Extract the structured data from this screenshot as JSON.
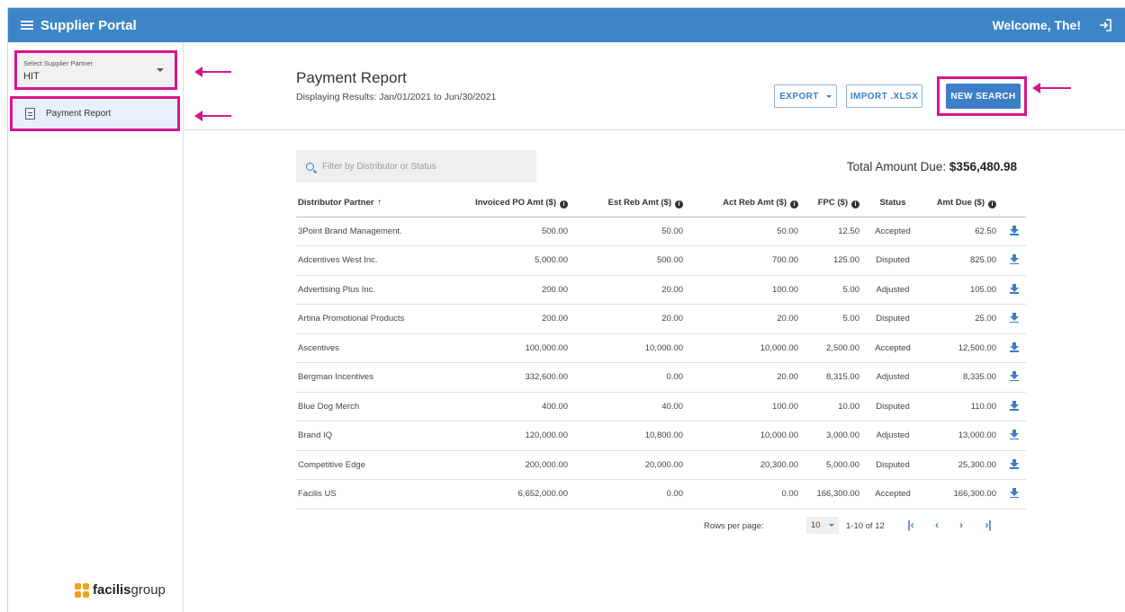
{
  "header": {
    "title": "Supplier Portal",
    "welcome": "Welcome, The!"
  },
  "sidebar": {
    "supplier_select": {
      "label": "Select Supplier Partner",
      "value": "HIT"
    },
    "nav_item": "Payment Report",
    "brand": {
      "bold": "facilis",
      "light": "group"
    }
  },
  "main": {
    "title": "Payment Report",
    "subtitle": "Displaying Results: Jan/01/2021 to Jun/30/2021",
    "buttons": {
      "export": "EXPORT",
      "import": "IMPORT .XLSX",
      "new_search": "NEW SEARCH"
    },
    "filter_placeholder": "Filter by Distributor or Status",
    "total_label": "Total Amount Due:",
    "total_value": "$356,480.98"
  },
  "table": {
    "columns": [
      "Distributor Partner",
      "Invoiced PO Amt ($)",
      "Est Reb Amt ($)",
      "Act Reb Amt ($)",
      "FPC ($)",
      "Status",
      "Amt Due ($)"
    ],
    "rows": [
      [
        "3Point Brand Management.",
        "500.00",
        "50.00",
        "50.00",
        "12.50",
        "Accepted",
        "62.50"
      ],
      [
        "Adcentives West Inc.",
        "5,000.00",
        "500.00",
        "700.00",
        "125.00",
        "Disputed",
        "825.00"
      ],
      [
        "Advertising Plus Inc.",
        "200.00",
        "20.00",
        "100.00",
        "5.00",
        "Adjusted",
        "105.00"
      ],
      [
        "Artina Promotional Products",
        "200.00",
        "20.00",
        "20.00",
        "5.00",
        "Disputed",
        "25.00"
      ],
      [
        "Ascentives",
        "100,000.00",
        "10,000.00",
        "10,000.00",
        "2,500.00",
        "Accepted",
        "12,500.00"
      ],
      [
        "Bergman Incentives",
        "332,600.00",
        "0.00",
        "20.00",
        "8,315.00",
        "Adjusted",
        "8,335.00"
      ],
      [
        "Blue Dog Merch",
        "400.00",
        "40.00",
        "100.00",
        "10.00",
        "Disputed",
        "110.00"
      ],
      [
        "Brand IQ",
        "120,000.00",
        "10,800.00",
        "10,000.00",
        "3,000.00",
        "Adjusted",
        "13,000.00"
      ],
      [
        "Competitive Edge",
        "200,000.00",
        "20,000.00",
        "20,300.00",
        "5,000.00",
        "Disputed",
        "25,300.00"
      ],
      [
        "Facilis US",
        "6,652,000.00",
        "0.00",
        "0.00",
        "166,300.00",
        "Accepted",
        "166,300.00"
      ]
    ]
  },
  "pagination": {
    "rows_per_page_label": "Rows per page:",
    "rows_per_page": "10",
    "range": "1-10 of 12"
  },
  "icons": [
    "menu-icon",
    "logout-icon",
    "document-icon",
    "search-icon",
    "info-icon",
    "sort-up-icon",
    "download-icon",
    "first-page-icon",
    "prev-page-icon",
    "next-page-icon",
    "last-page-icon"
  ],
  "colors": {
    "header_bg": "#3d85c6",
    "accent": "#3d7ec7",
    "highlight": "#d6158c",
    "brand_mark": "#f4a21c"
  }
}
